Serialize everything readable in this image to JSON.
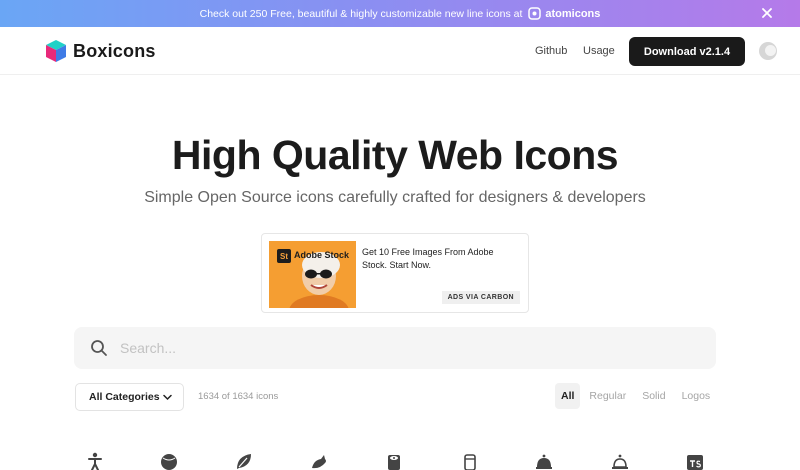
{
  "promo": {
    "text": "Check out 250 Free, beautiful & highly customizable new line icons at",
    "brand": "atomicons",
    "close_icon": "close-icon"
  },
  "header": {
    "logo_text": "Boxicons",
    "nav": {
      "github": "Github",
      "usage": "Usage"
    },
    "download_label": "Download v2.1.4",
    "theme_icon": "moon-icon"
  },
  "hero": {
    "title": "High Quality Web Icons",
    "subtitle": "Simple Open Source icons carefully crafted for designers & developers"
  },
  "ad": {
    "brand_badge": "St",
    "brand_label": "Adobe Stock",
    "text": "Get 10 Free Images From Adobe Stock. Start Now.",
    "via": "ADS VIA CARBON"
  },
  "search": {
    "placeholder": "Search..."
  },
  "filters": {
    "category": "All Categories",
    "count_text": "1634 of 1634 icons",
    "tabs": [
      "All",
      "Regular",
      "Solid",
      "Logos"
    ],
    "active_tab": "All"
  },
  "icons": [
    "accessibility-icon",
    "ball-icon",
    "leaf-icon",
    "bird-icon",
    "toilet-paper-icon",
    "beer-can-icon",
    "cloche-icon",
    "cloche-outline-icon",
    "typescript-icon"
  ],
  "colors": {
    "accent": "#1a1a1a",
    "banner_start": "#6aa6f5",
    "banner_end": "#b57ae9"
  }
}
